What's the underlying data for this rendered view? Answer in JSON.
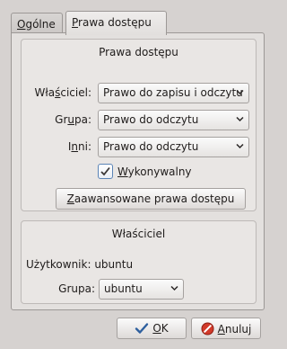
{
  "tabs": [
    {
      "label_mn": "O",
      "label_rest": "gólne",
      "active": false
    },
    {
      "label_mn": "P",
      "label_rest": "rawa dostępu",
      "active": true
    }
  ],
  "permissions": {
    "title": "Prawa dostępu",
    "owner_label_pre": "Wła",
    "owner_label_mn": "ś",
    "owner_label_post": "ciciel:",
    "owner_value": "Prawo do zapisu i odczytu",
    "group_label_pre": "Gr",
    "group_label_mn": "u",
    "group_label_post": "pa:",
    "group_value": "Prawo do odczytu",
    "others_label_pre": "I",
    "others_label_mn": "n",
    "others_label_post": "ni:",
    "others_value": "Prawo do odczytu",
    "executable_mn": "W",
    "executable_rest": "ykonywalny",
    "executable_checked": true,
    "advanced_mn": "Z",
    "advanced_rest": "aawansowane prawa dostępu"
  },
  "owner_section": {
    "title": "Właściciel",
    "user_label": "Użytkownik:",
    "user_value": "ubuntu",
    "group_label": "Grupa:",
    "group_value": "ubuntu"
  },
  "buttons": {
    "ok_mn": "O",
    "ok_rest": "K",
    "cancel_mn": "A",
    "cancel_rest": "nuluj"
  },
  "colors": {
    "ok_check": "#2e5f9e",
    "cancel_red": "#d23a2a"
  },
  "icons": {
    "ok": "check-icon",
    "cancel": "cancel-icon",
    "combo": "chevron-down-icon"
  }
}
